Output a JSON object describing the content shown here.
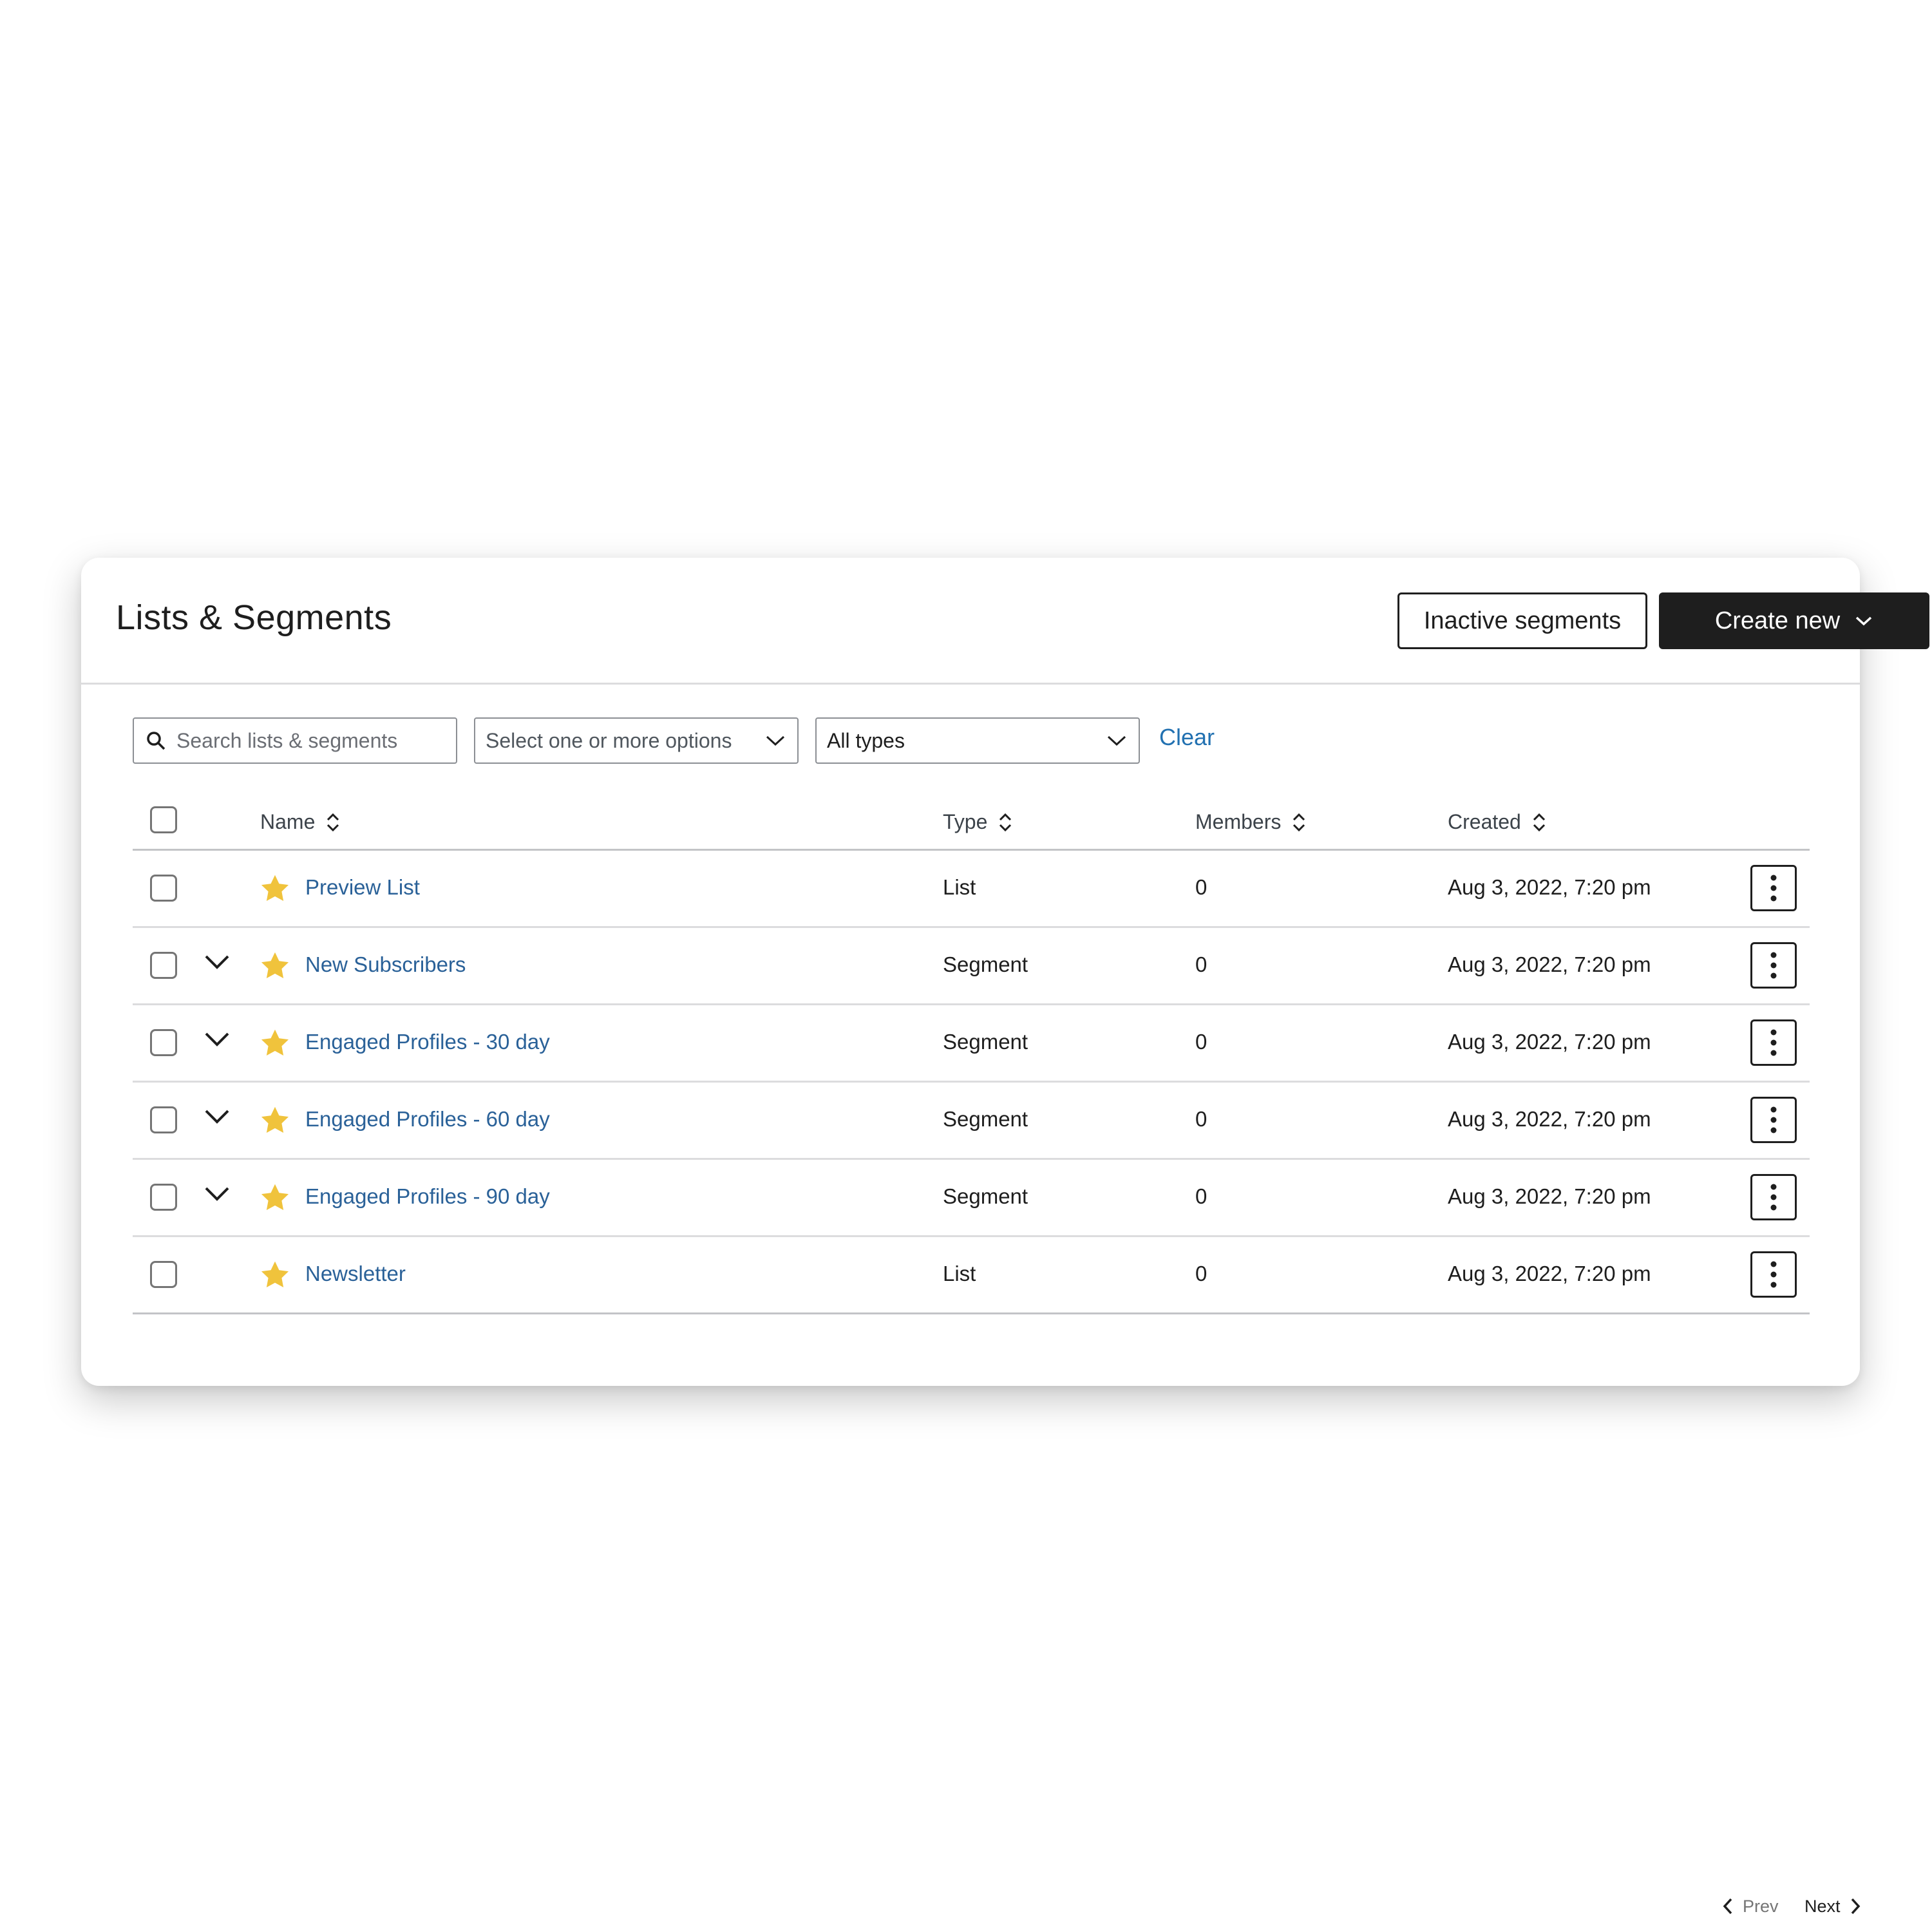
{
  "header": {
    "title": "Lists & Segments",
    "inactive_label": "Inactive segments",
    "create_label": "Create new"
  },
  "filters": {
    "search_placeholder": "Search lists & segments",
    "tags_placeholder": "Select one or more options",
    "type_value": "All types",
    "clear_label": "Clear"
  },
  "table": {
    "columns": {
      "name": "Name",
      "type": "Type",
      "members": "Members",
      "created": "Created"
    },
    "rows": [
      {
        "name": "Preview List",
        "type": "List",
        "members": "0",
        "created": "Aug 3, 2022, 7:20 pm",
        "expandable": false
      },
      {
        "name": "New Subscribers",
        "type": "Segment",
        "members": "0",
        "created": "Aug 3, 2022, 7:20 pm",
        "expandable": true
      },
      {
        "name": "Engaged Profiles - 30 day",
        "type": "Segment",
        "members": "0",
        "created": "Aug 3, 2022, 7:20 pm",
        "expandable": true
      },
      {
        "name": "Engaged Profiles - 60 day",
        "type": "Segment",
        "members": "0",
        "created": "Aug 3, 2022, 7:20 pm",
        "expandable": true
      },
      {
        "name": "Engaged Profiles - 90 day",
        "type": "Segment",
        "members": "0",
        "created": "Aug 3, 2022, 7:20 pm",
        "expandable": true
      },
      {
        "name": "Newsletter",
        "type": "List",
        "members": "0",
        "created": "Aug 3, 2022, 7:20 pm",
        "expandable": false
      }
    ]
  },
  "pagination": {
    "prev_label": "Prev",
    "next_label": "Next"
  },
  "colors": {
    "link": "#2a6198",
    "star": "#f0c33c",
    "dark_button": "#1e1e1e"
  },
  "icons": [
    "search-icon",
    "chevron-down-icon",
    "sort-icon",
    "star-icon",
    "more-vertical-icon",
    "chevron-left-icon",
    "chevron-right-icon"
  ]
}
